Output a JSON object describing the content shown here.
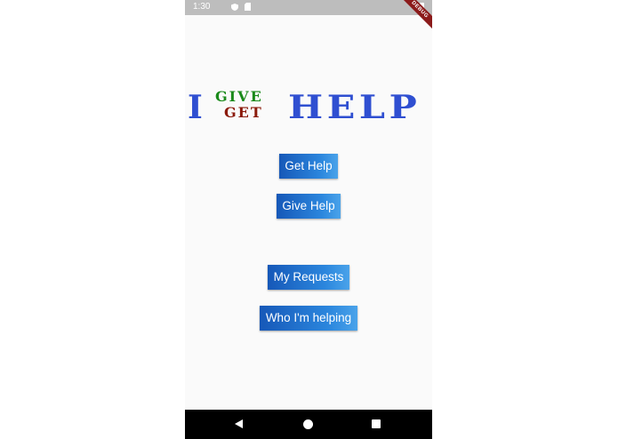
{
  "status_bar": {
    "time": "1:30",
    "icons": [
      "shield-icon",
      "sd-card-icon",
      "battery-icon"
    ]
  },
  "debug_banner": {
    "label": "DEBUG",
    "color": "#8b1a1a"
  },
  "logo": {
    "letter_i": "I",
    "word_give": "GIVE",
    "word_get": "GET",
    "word_help": "HELP",
    "colors": {
      "primary": "#2f4fd1",
      "give": "#1a8a1a",
      "get": "#8b1a0a"
    }
  },
  "buttons": {
    "get_help": "Get Help",
    "give_help": "Give Help",
    "my_requests": "My Requests",
    "who_helping": "Who I'm helping"
  },
  "nav_bar": {
    "icons": [
      "back-icon",
      "home-icon",
      "recents-icon"
    ]
  },
  "colors": {
    "button_start": "#1658b8",
    "button_end": "#4aa3ea",
    "background": "#fafafa"
  }
}
